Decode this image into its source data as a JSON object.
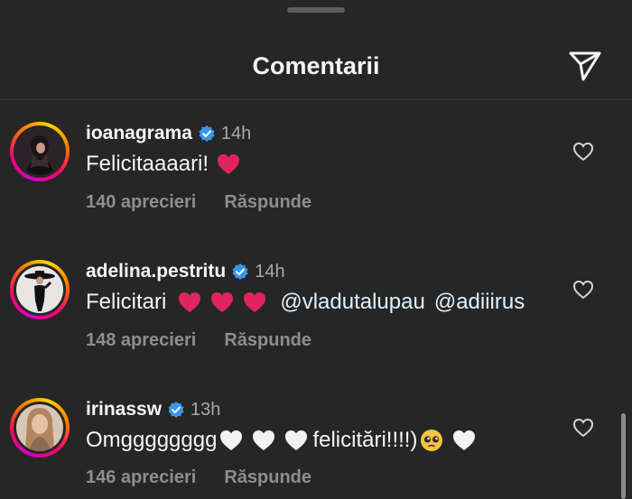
{
  "sheet": {
    "title": "Comentarii",
    "send_icon": "paper-plane-icon"
  },
  "comments": [
    {
      "username": "ioanagrama",
      "verified": true,
      "time": "14h",
      "text": "Felicitaaaari!",
      "emojis": [
        "red-heart"
      ],
      "likes": "140 aprecieri",
      "reply": "Răspunde"
    },
    {
      "username": "adelina.pestritu",
      "verified": true,
      "time": "14h",
      "text": "Felicitari",
      "emojis": [
        "red-heart",
        "red-heart",
        "red-heart"
      ],
      "mentions": [
        "@vladutalupau",
        "@adiiirus"
      ],
      "likes": "148 aprecieri",
      "reply": "Răspunde"
    },
    {
      "username": "irinassw",
      "verified": true,
      "time": "13h",
      "text_before": "Omgggggggg",
      "text_middle": "felicitări!!!!)",
      "emojis": [
        "white-heart",
        "white-heart",
        "white-heart",
        "pleading-face",
        "white-heart"
      ],
      "likes": "146 aprecieri",
      "reply": "Răspunde"
    }
  ],
  "colors": {
    "background": "#262626",
    "text": "#f5f5f5",
    "secondary": "#a8a8a8",
    "verified": "#3797f0",
    "red_heart": "#e0245e"
  }
}
